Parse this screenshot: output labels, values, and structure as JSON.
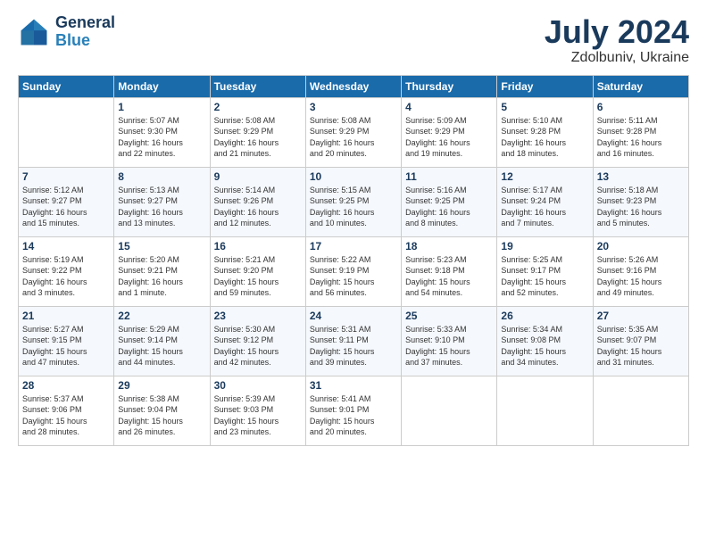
{
  "header": {
    "logo_general": "General",
    "logo_blue": "Blue",
    "month_title": "July 2024",
    "location": "Zdolbuniv, Ukraine"
  },
  "weekdays": [
    "Sunday",
    "Monday",
    "Tuesday",
    "Wednesday",
    "Thursday",
    "Friday",
    "Saturday"
  ],
  "weeks": [
    [
      {
        "day": "",
        "info": ""
      },
      {
        "day": "1",
        "info": "Sunrise: 5:07 AM\nSunset: 9:30 PM\nDaylight: 16 hours\nand 22 minutes."
      },
      {
        "day": "2",
        "info": "Sunrise: 5:08 AM\nSunset: 9:29 PM\nDaylight: 16 hours\nand 21 minutes."
      },
      {
        "day": "3",
        "info": "Sunrise: 5:08 AM\nSunset: 9:29 PM\nDaylight: 16 hours\nand 20 minutes."
      },
      {
        "day": "4",
        "info": "Sunrise: 5:09 AM\nSunset: 9:29 PM\nDaylight: 16 hours\nand 19 minutes."
      },
      {
        "day": "5",
        "info": "Sunrise: 5:10 AM\nSunset: 9:28 PM\nDaylight: 16 hours\nand 18 minutes."
      },
      {
        "day": "6",
        "info": "Sunrise: 5:11 AM\nSunset: 9:28 PM\nDaylight: 16 hours\nand 16 minutes."
      }
    ],
    [
      {
        "day": "7",
        "info": "Sunrise: 5:12 AM\nSunset: 9:27 PM\nDaylight: 16 hours\nand 15 minutes."
      },
      {
        "day": "8",
        "info": "Sunrise: 5:13 AM\nSunset: 9:27 PM\nDaylight: 16 hours\nand 13 minutes."
      },
      {
        "day": "9",
        "info": "Sunrise: 5:14 AM\nSunset: 9:26 PM\nDaylight: 16 hours\nand 12 minutes."
      },
      {
        "day": "10",
        "info": "Sunrise: 5:15 AM\nSunset: 9:25 PM\nDaylight: 16 hours\nand 10 minutes."
      },
      {
        "day": "11",
        "info": "Sunrise: 5:16 AM\nSunset: 9:25 PM\nDaylight: 16 hours\nand 8 minutes."
      },
      {
        "day": "12",
        "info": "Sunrise: 5:17 AM\nSunset: 9:24 PM\nDaylight: 16 hours\nand 7 minutes."
      },
      {
        "day": "13",
        "info": "Sunrise: 5:18 AM\nSunset: 9:23 PM\nDaylight: 16 hours\nand 5 minutes."
      }
    ],
    [
      {
        "day": "14",
        "info": "Sunrise: 5:19 AM\nSunset: 9:22 PM\nDaylight: 16 hours\nand 3 minutes."
      },
      {
        "day": "15",
        "info": "Sunrise: 5:20 AM\nSunset: 9:21 PM\nDaylight: 16 hours\nand 1 minute."
      },
      {
        "day": "16",
        "info": "Sunrise: 5:21 AM\nSunset: 9:20 PM\nDaylight: 15 hours\nand 59 minutes."
      },
      {
        "day": "17",
        "info": "Sunrise: 5:22 AM\nSunset: 9:19 PM\nDaylight: 15 hours\nand 56 minutes."
      },
      {
        "day": "18",
        "info": "Sunrise: 5:23 AM\nSunset: 9:18 PM\nDaylight: 15 hours\nand 54 minutes."
      },
      {
        "day": "19",
        "info": "Sunrise: 5:25 AM\nSunset: 9:17 PM\nDaylight: 15 hours\nand 52 minutes."
      },
      {
        "day": "20",
        "info": "Sunrise: 5:26 AM\nSunset: 9:16 PM\nDaylight: 15 hours\nand 49 minutes."
      }
    ],
    [
      {
        "day": "21",
        "info": "Sunrise: 5:27 AM\nSunset: 9:15 PM\nDaylight: 15 hours\nand 47 minutes."
      },
      {
        "day": "22",
        "info": "Sunrise: 5:29 AM\nSunset: 9:14 PM\nDaylight: 15 hours\nand 44 minutes."
      },
      {
        "day": "23",
        "info": "Sunrise: 5:30 AM\nSunset: 9:12 PM\nDaylight: 15 hours\nand 42 minutes."
      },
      {
        "day": "24",
        "info": "Sunrise: 5:31 AM\nSunset: 9:11 PM\nDaylight: 15 hours\nand 39 minutes."
      },
      {
        "day": "25",
        "info": "Sunrise: 5:33 AM\nSunset: 9:10 PM\nDaylight: 15 hours\nand 37 minutes."
      },
      {
        "day": "26",
        "info": "Sunrise: 5:34 AM\nSunset: 9:08 PM\nDaylight: 15 hours\nand 34 minutes."
      },
      {
        "day": "27",
        "info": "Sunrise: 5:35 AM\nSunset: 9:07 PM\nDaylight: 15 hours\nand 31 minutes."
      }
    ],
    [
      {
        "day": "28",
        "info": "Sunrise: 5:37 AM\nSunset: 9:06 PM\nDaylight: 15 hours\nand 28 minutes."
      },
      {
        "day": "29",
        "info": "Sunrise: 5:38 AM\nSunset: 9:04 PM\nDaylight: 15 hours\nand 26 minutes."
      },
      {
        "day": "30",
        "info": "Sunrise: 5:39 AM\nSunset: 9:03 PM\nDaylight: 15 hours\nand 23 minutes."
      },
      {
        "day": "31",
        "info": "Sunrise: 5:41 AM\nSunset: 9:01 PM\nDaylight: 15 hours\nand 20 minutes."
      },
      {
        "day": "",
        "info": ""
      },
      {
        "day": "",
        "info": ""
      },
      {
        "day": "",
        "info": ""
      }
    ]
  ]
}
